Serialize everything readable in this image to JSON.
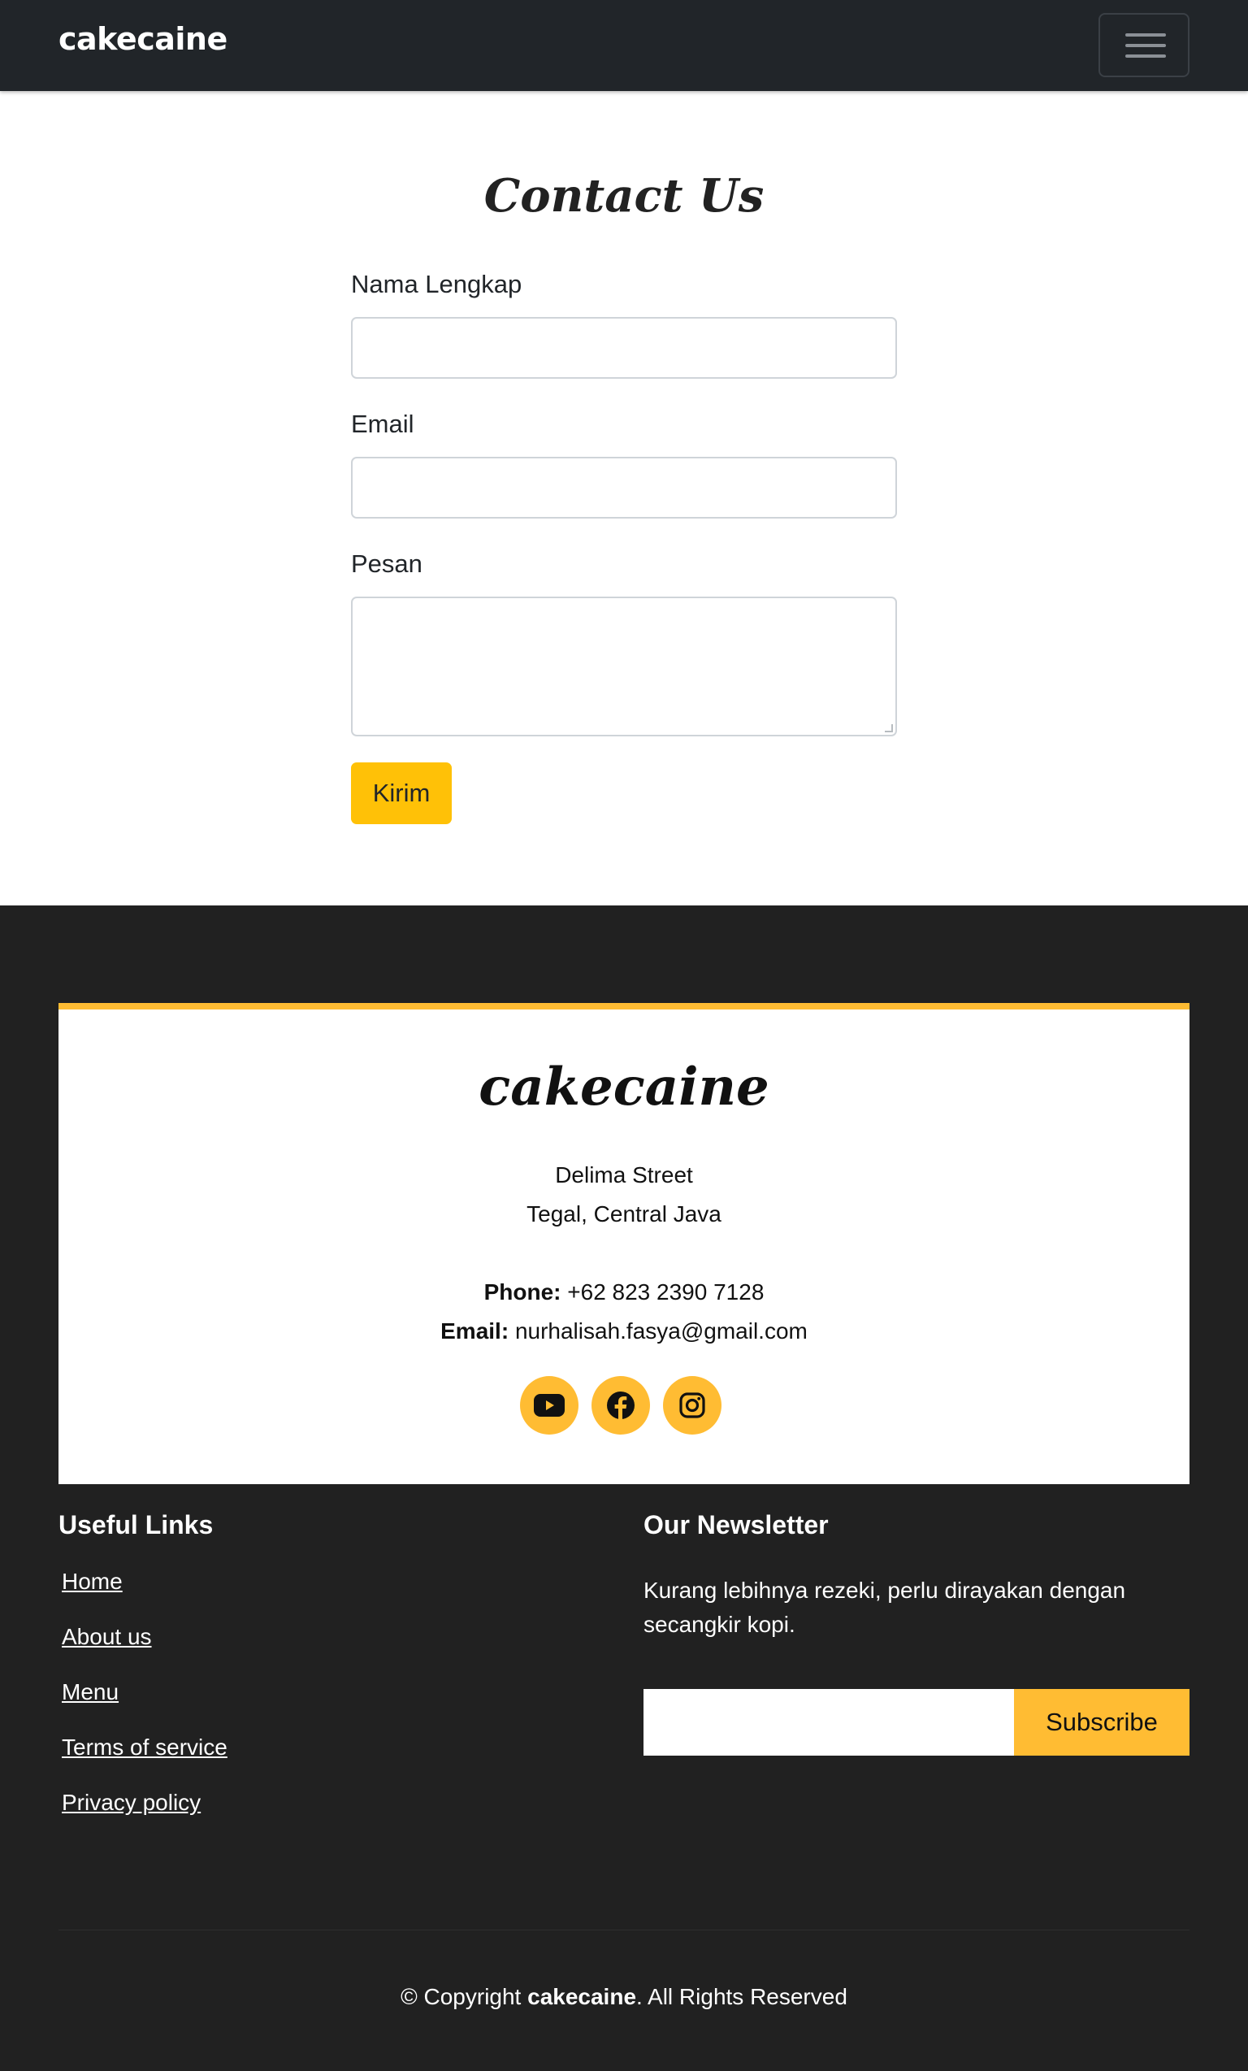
{
  "navbar": {
    "brand": "cakecaine",
    "menu_icon": "hamburger-menu-icon"
  },
  "contact": {
    "title": "Contact Us",
    "fields": {
      "name_label": "Nama Lengkap",
      "name_value": "",
      "email_label": "Email",
      "email_value": "",
      "message_label": "Pesan",
      "message_value": ""
    },
    "submit_label": "Kirim"
  },
  "footer": {
    "logo": "cakecaine",
    "address_line1": "Delima Street",
    "address_line2": "Tegal, Central Java",
    "phone_label": "Phone:",
    "phone_value": "+62 823 2390 7128",
    "email_label": "Email:",
    "email_value": "nurhalisah.fasya@gmail.com",
    "socials": [
      "youtube-icon",
      "facebook-icon",
      "instagram-icon"
    ],
    "useful_links": {
      "title": "Useful Links",
      "items": [
        "Home",
        "About us",
        "Menu",
        "Terms of service",
        "Privacy policy"
      ]
    },
    "newsletter": {
      "title": "Our Newsletter",
      "text": "Kurang lebihnya rezeki, perlu dirayakan dengan secangkir kopi.",
      "input_value": "",
      "button_label": "Subscribe"
    },
    "copyright": {
      "prefix": "© Copyright ",
      "brand": "cakecaine",
      "suffix": ". All Rights Reserved"
    }
  },
  "colors": {
    "navbar_bg": "#212529",
    "footer_bg": "#212121",
    "accent": "#ffbc33",
    "button_yellow": "#ffc107"
  }
}
